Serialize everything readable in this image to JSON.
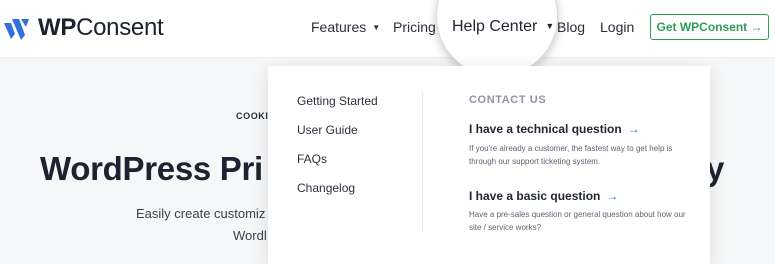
{
  "brand": {
    "name_bold": "WP",
    "name_rest": "Consent",
    "logo_color": "#2f6fe0"
  },
  "nav": {
    "features": "Features",
    "pricing": "Pricing",
    "help_center": "Help Center",
    "blog": "Blog",
    "login": "Login",
    "cta": "Get WPConsent →"
  },
  "hero": {
    "kicker": "COOKI",
    "title": "WordPress Pri",
    "title_end": "y",
    "sub1": "Easily create customiz",
    "sub2": "Wordl"
  },
  "dropdown": {
    "links": [
      "Getting Started",
      "User Guide",
      "FAQs",
      "Changelog"
    ],
    "contact_heading": "CONTACT US",
    "questions": [
      {
        "title": "I have a technical question",
        "desc": "If you're already a customer, the fastest way to get help is through our support ticketing system."
      },
      {
        "title": "I have a basic question",
        "desc": "Have a pre-sales question or general question about how our site / service works?"
      }
    ],
    "arrow": "→"
  },
  "colors": {
    "accent_green": "#2f9d5a",
    "accent_blue": "#2f6fe0"
  }
}
